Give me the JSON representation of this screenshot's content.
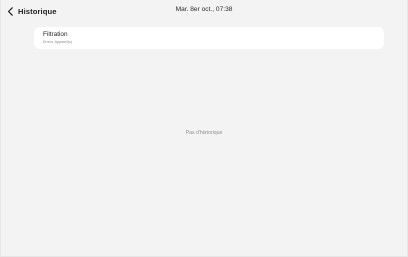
{
  "header": {
    "back_label": "Historique",
    "datetime": "Mar. 8er oct., 07:38"
  },
  "card": {
    "title": "Filtration",
    "subtitle": "Erreur, Appareil(s)"
  },
  "main": {
    "empty_message": "Pas d'historique"
  },
  "icons": {
    "back": "chevron-left-icon"
  }
}
